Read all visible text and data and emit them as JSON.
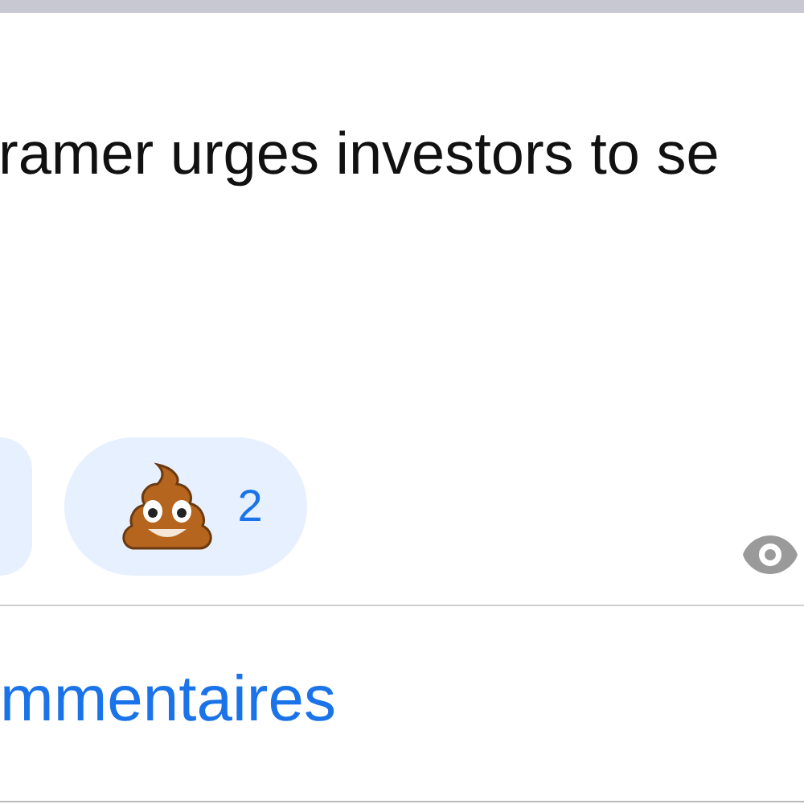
{
  "post": {
    "text": "ramer urges investors to se"
  },
  "reactions": [
    {
      "kind": "poop",
      "count": "2"
    }
  ],
  "comments_link": "mmentaires"
}
